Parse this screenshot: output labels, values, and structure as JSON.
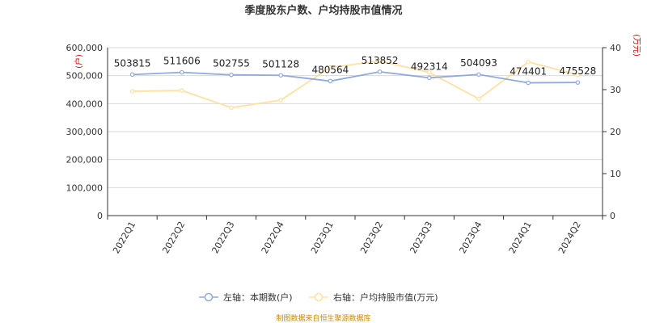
{
  "page": {
    "title": "季度股东户数、户均持股市值情况",
    "footer": "制图数据来自恒生聚源数据库"
  },
  "colors": {
    "left_series": "#8faadc",
    "right_series": "#ffe0a3",
    "grid": "#d9d9d9",
    "axis": "#333333",
    "unit": "#cc0000",
    "footer": "#cc8800"
  },
  "chart_data": {
    "type": "line",
    "title": "季度股东户数、户均持股市值情况",
    "categories": [
      "2022Q1",
      "2022Q2",
      "2022Q3",
      "2022Q4",
      "2023Q1",
      "2023Q2",
      "2023Q3",
      "2023Q4",
      "2024Q1",
      "2024Q2"
    ],
    "left_axis": {
      "unit": "(户)",
      "ylim": [
        0,
        600000
      ],
      "ticks": [
        0,
        100000,
        200000,
        300000,
        400000,
        500000,
        600000
      ],
      "tick_labels": [
        "0",
        "100,000",
        "200,000",
        "300,000",
        "400,000",
        "500,000",
        "600,000"
      ]
    },
    "right_axis": {
      "unit": "(万元)",
      "ylim": [
        0,
        40
      ],
      "ticks": [
        0,
        10,
        20,
        30,
        40
      ],
      "tick_labels": [
        "0",
        "10",
        "20",
        "30",
        "40"
      ]
    },
    "series": [
      {
        "name": "左轴：本期数(户)",
        "axis": "left",
        "values": [
          503815,
          511606,
          502755,
          501128,
          480564,
          513852,
          492314,
          504093,
          474401,
          475528
        ],
        "labels": [
          "503815",
          "511606",
          "502755",
          "501128",
          "480564",
          "513852",
          "492314",
          "504093",
          "474401",
          "475528"
        ]
      },
      {
        "name": "右轴：户均持股市值(万元)",
        "axis": "right",
        "values": [
          29.6,
          29.8,
          25.7,
          27.5,
          35.3,
          36.8,
          34.1,
          27.8,
          36.6,
          33.5
        ]
      }
    ],
    "grid": true,
    "legend": "bottom"
  }
}
